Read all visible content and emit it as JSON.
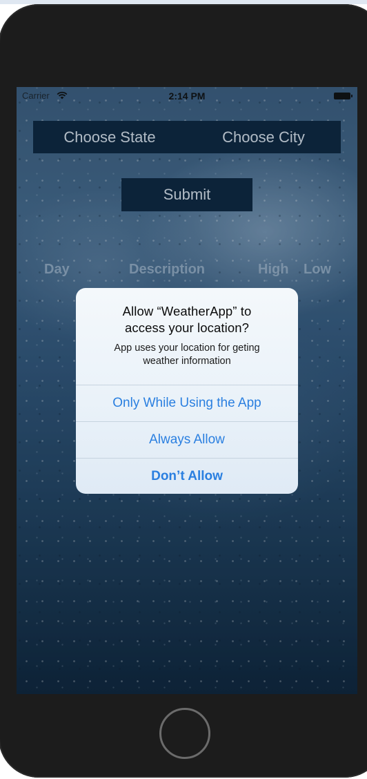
{
  "status_bar": {
    "carrier": "Carrier",
    "time": "2:14 PM"
  },
  "selector": {
    "state_label": "Choose State",
    "city_label": "Choose City"
  },
  "submit_label": "Submit",
  "table_headers": {
    "day": "Day",
    "description": "Description",
    "high": "High",
    "low": "Low"
  },
  "alert": {
    "title_line1": "Allow “WeatherApp” to",
    "title_line2": "access your location?",
    "message_line1": "App uses your location for geting",
    "message_line2": "weather information",
    "buttons": [
      {
        "label": "Only While Using the App"
      },
      {
        "label": "Always Allow"
      },
      {
        "label": "Don’t Allow"
      }
    ]
  },
  "colors": {
    "accent": "#2a7fe0",
    "bar_background": "#0e263f",
    "phone_body": "#1c1c1c"
  },
  "icons": {
    "wifi": "wifi-icon",
    "battery": "battery-icon",
    "home": "home-button"
  }
}
